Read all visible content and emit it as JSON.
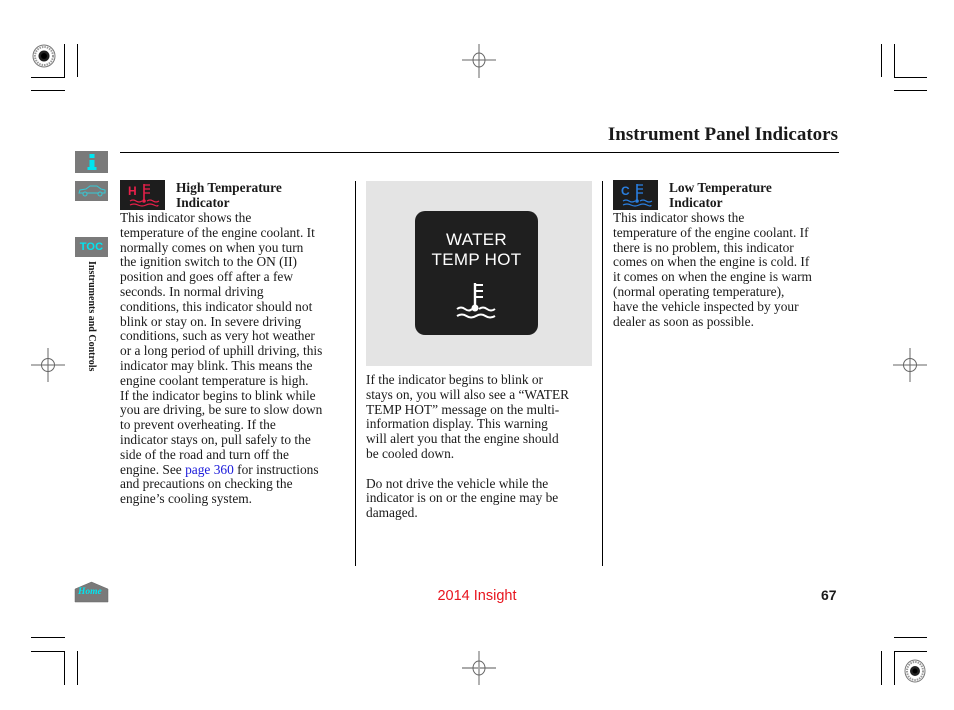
{
  "header": {
    "title": "Instrument Panel Indicators"
  },
  "sidebar": {
    "info_button": {
      "icon": "info-icon"
    },
    "vehicle_button": {
      "icon": "car-icon"
    },
    "toc_button": {
      "label": "TOC"
    },
    "section_label": "Instruments and Controls",
    "home_button": {
      "label": "Home"
    }
  },
  "columns": [
    {
      "icon": {
        "name": "high-temperature-icon",
        "letter": "H",
        "color": "#e8204a"
      },
      "heading_line1": "High Temperature",
      "heading_line2": "Indicator",
      "lines": [
        "This indicator shows the",
        "temperature of the engine coolant. It",
        "normally comes on when you turn",
        "the ignition switch to the ON (II)",
        "position and goes off after a few",
        "seconds. In normal driving",
        "conditions, this indicator should not",
        "blink or stay on. In severe driving",
        "conditions, such as very hot weather",
        "or a long period of uphill driving, this",
        "indicator may blink. This means the",
        "engine coolant temperature is high.",
        "If the indicator begins to blink while",
        "you are driving, be sure to slow down",
        "to prevent overheating. If the",
        "indicator stays on, pull safely to the",
        "side of the road and turn off the"
      ],
      "link_line_prefix": "engine. See ",
      "link_text": "page 360",
      "link_line_suffix": " for instructions",
      "after_link_lines": [
        "and precautions on checking the",
        "engine’s cooling system."
      ]
    },
    {
      "display": {
        "line1": "WATER",
        "line2": "TEMP HOT",
        "icon": "coolant-temperature-icon"
      },
      "paragraph1_lines": [
        "If the indicator begins to blink or",
        "stays on, you will also see a “WATER",
        "TEMP HOT” message on the multi-",
        "information display. This warning",
        "will alert you that the engine should",
        "be cooled down."
      ],
      "paragraph2_lines": [
        "Do not drive the vehicle while the",
        "indicator is on or the engine may be",
        "damaged."
      ]
    },
    {
      "icon": {
        "name": "low-temperature-icon",
        "letter": "C",
        "color": "#2a7fe0"
      },
      "heading_line1": "Low Temperature",
      "heading_line2": "Indicator",
      "lines": [
        "This indicator shows the",
        "temperature of the engine coolant. If",
        "there is no problem, this indicator",
        "comes on when the engine is cold. If",
        "it comes on when the engine is warm",
        "(normal operating temperature),",
        "have the vehicle inspected by your",
        "dealer as soon as possible."
      ]
    }
  ],
  "footer": {
    "model": "2014 Insight",
    "model_color": "#e8141e",
    "page_number": "67"
  }
}
